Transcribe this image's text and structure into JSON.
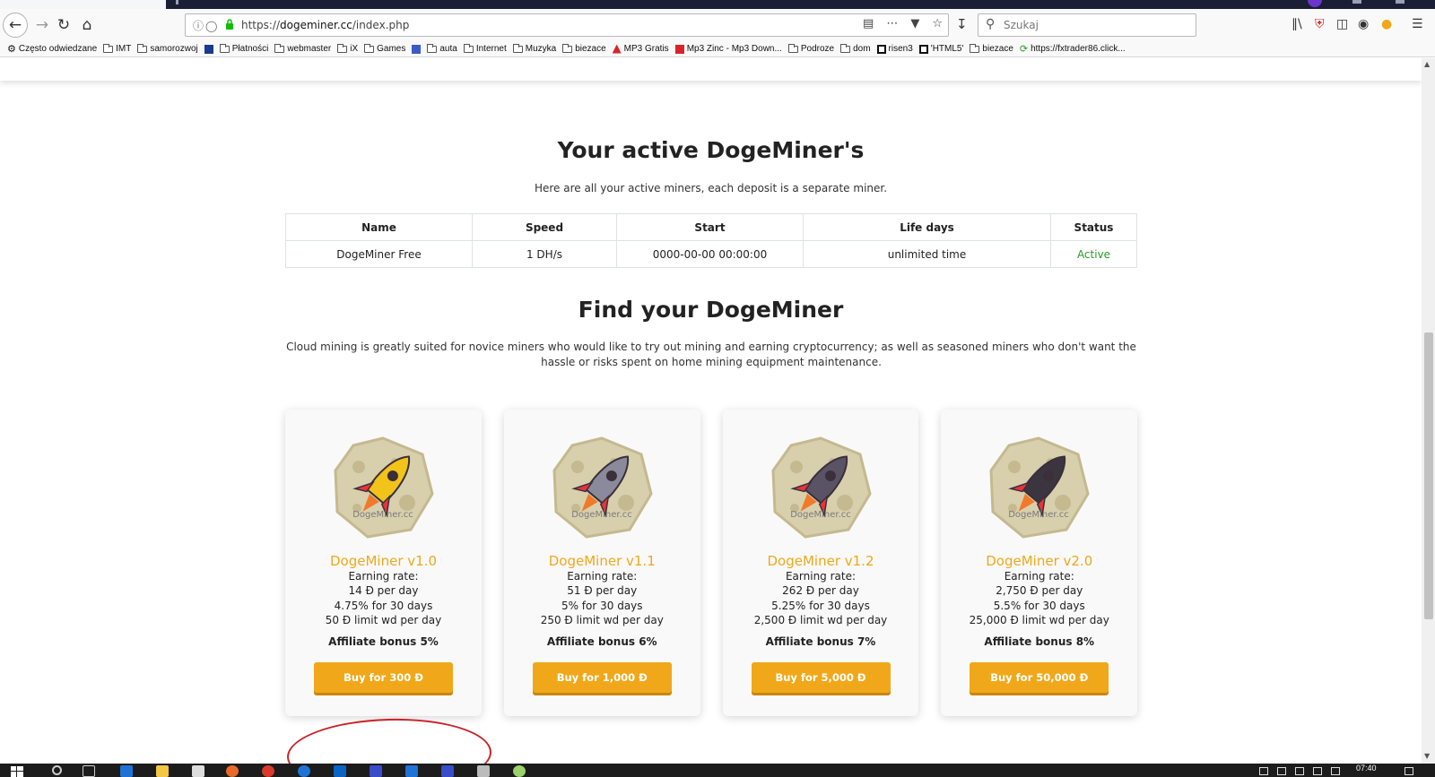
{
  "browser": {
    "url_host": "dogeminer.cc",
    "url_prefix": "https://",
    "url_path": "/index.php",
    "search_placeholder": "Szukaj",
    "bookmarks": [
      {
        "label": "Często odwiedzane",
        "icon": "gear-icon"
      },
      {
        "label": "IMT",
        "icon": "folder-icon"
      },
      {
        "label": "samorozwoj",
        "icon": "folder-icon"
      },
      {
        "label": "",
        "icon": "app-icon"
      },
      {
        "label": "Płatności",
        "icon": "folder-icon"
      },
      {
        "label": "webmaster",
        "icon": "folder-icon"
      },
      {
        "label": "iX",
        "icon": "folder-icon"
      },
      {
        "label": "Games",
        "icon": "folder-icon"
      },
      {
        "label": "",
        "icon": "site-icon"
      },
      {
        "label": "auta",
        "icon": "folder-icon"
      },
      {
        "label": "Internet",
        "icon": "folder-icon"
      },
      {
        "label": "Muzyka",
        "icon": "folder-icon"
      },
      {
        "label": "biezace",
        "icon": "folder-icon"
      },
      {
        "label": "MP3 Gratis",
        "icon": "mp3-icon"
      },
      {
        "label": "Mp3 Zinc - Mp3 Down...",
        "icon": "zinc-icon"
      },
      {
        "label": "Podroze",
        "icon": "folder-icon"
      },
      {
        "label": "dom",
        "icon": "folder-icon"
      },
      {
        "label": "risen3",
        "icon": "page-icon"
      },
      {
        "label": "'HTML5'",
        "icon": "page-icon"
      },
      {
        "label": "biezace",
        "icon": "folder-icon"
      },
      {
        "label": "https://fxtrader86.click...",
        "icon": "refresh-icon"
      }
    ]
  },
  "active_section": {
    "title": "Your active DogeMiner's",
    "subtitle": "Here are all your active miners, each deposit is a separate miner.",
    "columns": [
      "Name",
      "Speed",
      "Start",
      "Life days",
      "Status"
    ],
    "rows": [
      {
        "name": "DogeMiner Free",
        "speed": "1 DH/s",
        "start": "0000-00-00 00:00:00",
        "life": "unlimited time",
        "status": "Active"
      }
    ]
  },
  "find_section": {
    "title": "Find your DogeMiner",
    "description": "Cloud mining is greatly suited for novice miners who would like to try out mining and earning cryptocurrency; as well as seasoned miners who don't want the hassle or risks spent on home mining equipment maintenance."
  },
  "plans": [
    {
      "name": "DogeMiner v1.0",
      "earning_label": "Earning rate:",
      "per_day": "14 Ð per day",
      "rate": "4.75% for 30 days",
      "limit": "50 Ð limit wd per day",
      "affiliate": "Affiliate bonus 5%",
      "buy": "Buy for 300 Ð",
      "rocket_color": "#f2c318",
      "watermark": "DogeMiner.cc"
    },
    {
      "name": "DogeMiner v1.1",
      "earning_label": "Earning rate:",
      "per_day": "51 Ð per day",
      "rate": "5% for 30 days",
      "limit": "250 Ð limit wd per day",
      "affiliate": "Affiliate bonus 6%",
      "buy": "Buy for 1,000 Ð",
      "rocket_color": "#8a8a9c",
      "watermark": "DogeMiner.cc"
    },
    {
      "name": "DogeMiner v1.2",
      "earning_label": "Earning rate:",
      "per_day": "262 Ð per day",
      "rate": "5.25% for 30 days",
      "limit": "2,500 Ð limit wd per day",
      "affiliate": "Affiliate bonus 7%",
      "buy": "Buy for 5,000 Ð",
      "rocket_color": "#5a5366",
      "watermark": "DogeMiner.cc"
    },
    {
      "name": "DogeMiner v2.0",
      "earning_label": "Earning rate:",
      "per_day": "2,750 Ð per day",
      "rate": "5.5% for 30 days",
      "limit": "25,000 Ð limit wd per day",
      "affiliate": "Affiliate bonus 8%",
      "buy": "Buy for 50,000 Ð",
      "rocket_color": "#3b3540",
      "watermark": "DogeMiner.cc"
    }
  ],
  "taskbar": {
    "clock": "07:40"
  },
  "colors": {
    "accent": "#f0a81a",
    "active_status": "#2a9a2a",
    "annotation": "#c8242b"
  }
}
